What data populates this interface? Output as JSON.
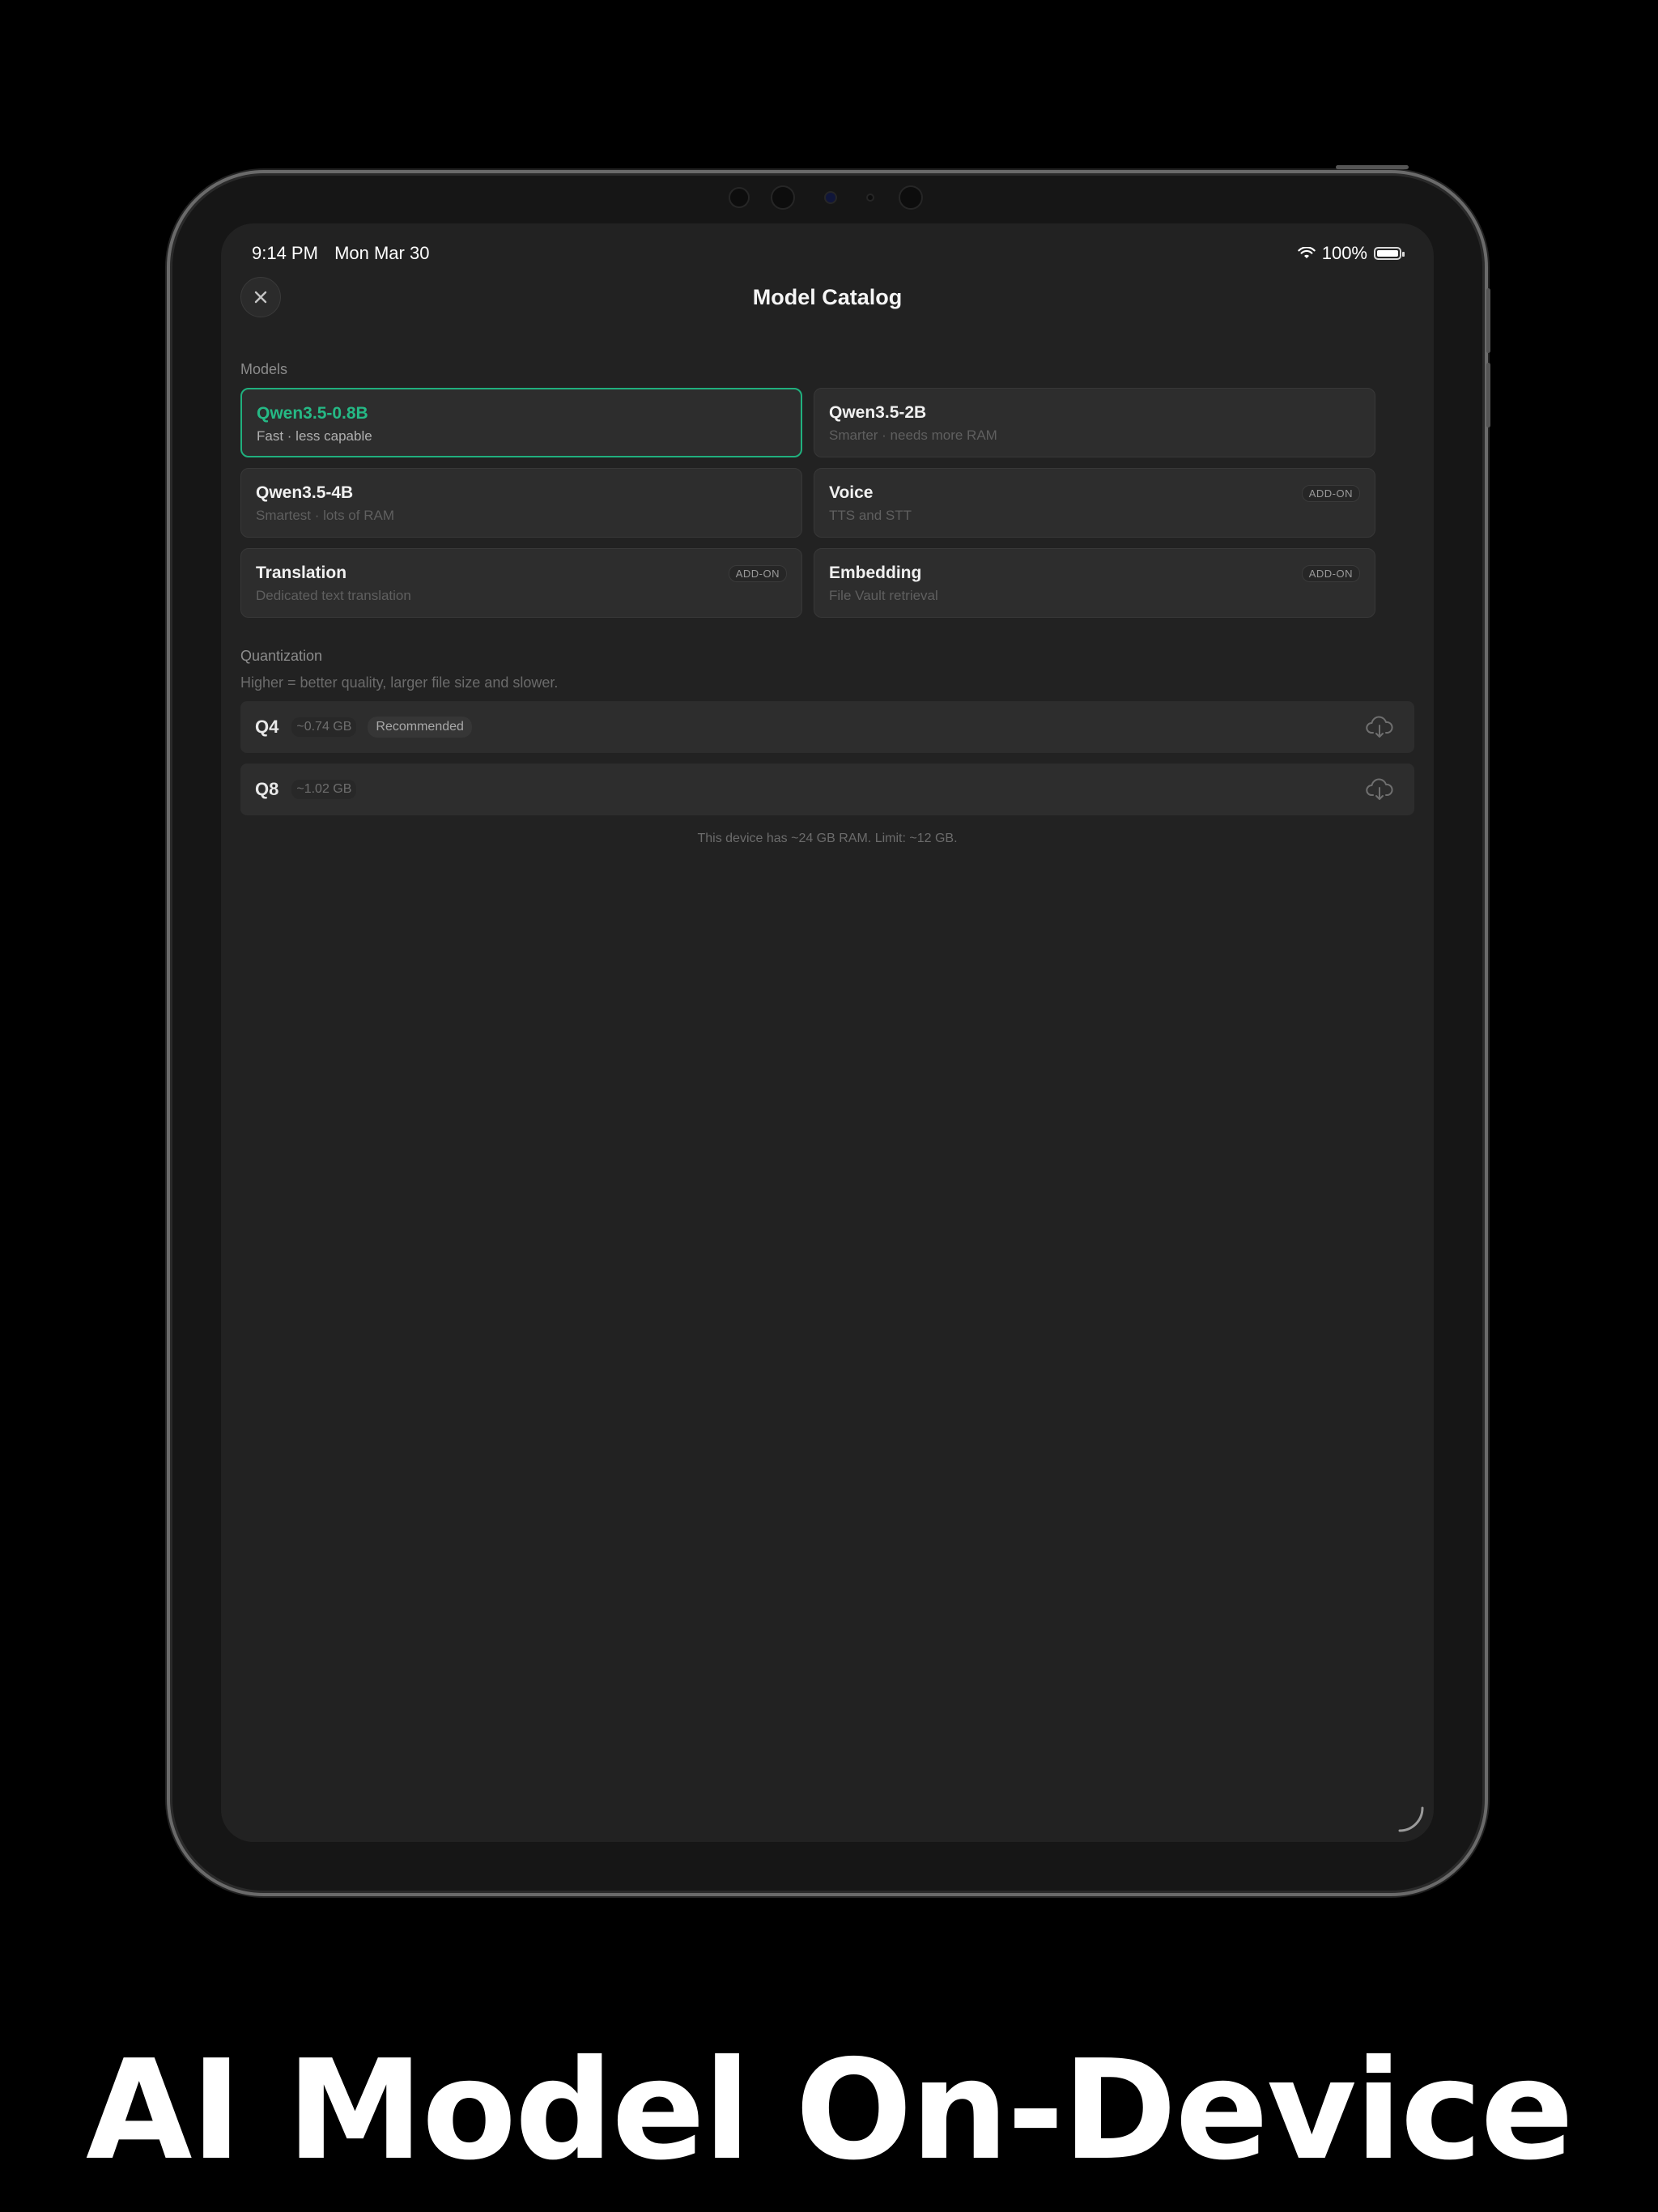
{
  "status_bar": {
    "time": "9:14 PM",
    "date": "Mon Mar 30",
    "battery": "100%"
  },
  "header": {
    "title": "Model Catalog"
  },
  "models_section": {
    "label": "Models",
    "cards": [
      {
        "name": "Qwen3.5-0.8B",
        "desc": "Fast · less capable",
        "selected": true
      },
      {
        "name": "Qwen3.5-2B",
        "desc": "Smarter · needs more RAM"
      },
      {
        "name": "Qwen3.5-4B",
        "desc": "Smartest · lots of RAM"
      },
      {
        "name": "Voice",
        "desc": "TTS and STT",
        "badge": "ADD-ON"
      },
      {
        "name": "Translation",
        "desc": "Dedicated text translation",
        "badge": "ADD-ON"
      },
      {
        "name": "Embedding",
        "desc": "File Vault retrieval",
        "badge": "ADD-ON"
      }
    ]
  },
  "quantization_section": {
    "label": "Quantization",
    "hint": "Higher = better quality, larger file size and slower.",
    "options": [
      {
        "name": "Q4",
        "size": "~0.74 GB",
        "badge": "Recommended",
        "icon": "cloud-download-icon"
      },
      {
        "name": "Q8",
        "size": "~1.02 GB",
        "icon": "cloud-download-icon"
      }
    ],
    "device_note": "This device has ~24 GB RAM. Limit: ~12 GB."
  },
  "caption": "AI Model On-Device",
  "colors": {
    "accent": "#25b985",
    "background": "#222222",
    "card": "#2d2d2d"
  }
}
